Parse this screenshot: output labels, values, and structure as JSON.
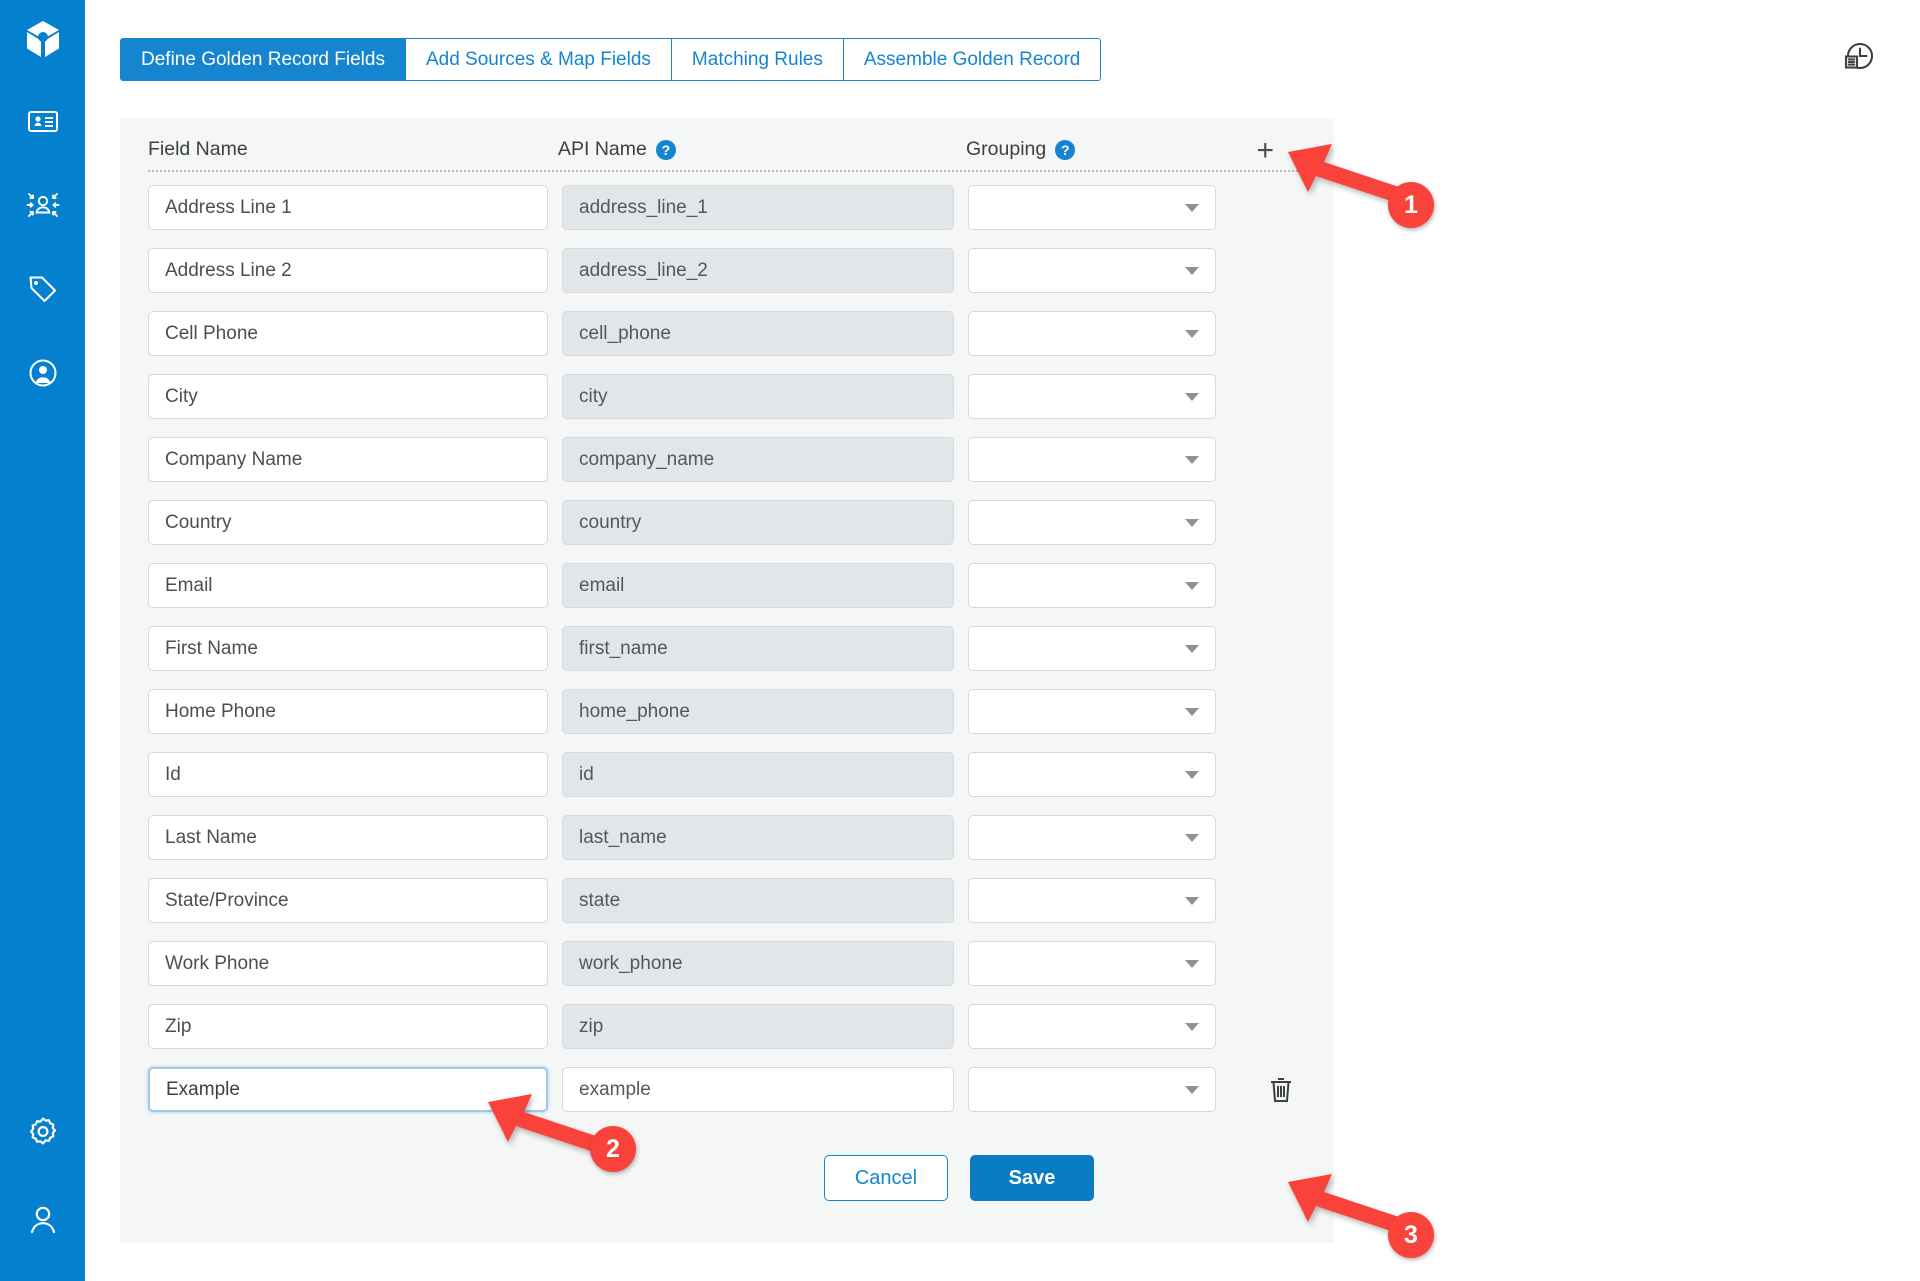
{
  "sidebar": {
    "logo": {
      "icon": "cube-logo-icon"
    },
    "nav_top": [
      {
        "icon": "contact-card-icon",
        "name": "contacts"
      },
      {
        "icon": "person-match-icon",
        "name": "match"
      },
      {
        "icon": "tag-icon",
        "name": "tags"
      },
      {
        "icon": "person-search-icon",
        "name": "person-search"
      }
    ],
    "nav_bottom": [
      {
        "icon": "gear-icon",
        "name": "settings"
      },
      {
        "icon": "user-icon",
        "name": "account"
      }
    ]
  },
  "header": {
    "history_icon": "history-clock-icon"
  },
  "tabs": [
    {
      "label": "Define Golden Record Fields",
      "active": true
    },
    {
      "label": "Add Sources & Map Fields",
      "active": false
    },
    {
      "label": "Matching Rules",
      "active": false
    },
    {
      "label": "Assemble Golden Record",
      "active": false
    }
  ],
  "table": {
    "columns": [
      {
        "label": "Field Name",
        "help": false
      },
      {
        "label": "API Name",
        "help": true,
        "help_glyph": "?"
      },
      {
        "label": "Grouping",
        "help": true,
        "help_glyph": "?"
      }
    ],
    "add_row_glyph": "+",
    "rows": [
      {
        "field_name": "Address Line 1",
        "api_name": "address_line_1",
        "grouping": "",
        "api_editable": false,
        "selected": false,
        "deletable": false
      },
      {
        "field_name": "Address Line 2",
        "api_name": "address_line_2",
        "grouping": "",
        "api_editable": false,
        "selected": false,
        "deletable": false
      },
      {
        "field_name": "Cell Phone",
        "api_name": "cell_phone",
        "grouping": "",
        "api_editable": false,
        "selected": false,
        "deletable": false
      },
      {
        "field_name": "City",
        "api_name": "city",
        "grouping": "",
        "api_editable": false,
        "selected": false,
        "deletable": false
      },
      {
        "field_name": "Company Name",
        "api_name": "company_name",
        "grouping": "",
        "api_editable": false,
        "selected": false,
        "deletable": false
      },
      {
        "field_name": "Country",
        "api_name": "country",
        "grouping": "",
        "api_editable": false,
        "selected": false,
        "deletable": false
      },
      {
        "field_name": "Email",
        "api_name": "email",
        "grouping": "",
        "api_editable": false,
        "selected": false,
        "deletable": false
      },
      {
        "field_name": "First Name",
        "api_name": "first_name",
        "grouping": "",
        "api_editable": false,
        "selected": false,
        "deletable": false
      },
      {
        "field_name": "Home Phone",
        "api_name": "home_phone",
        "grouping": "",
        "api_editable": false,
        "selected": false,
        "deletable": false
      },
      {
        "field_name": "Id",
        "api_name": "id",
        "grouping": "",
        "api_editable": false,
        "selected": false,
        "deletable": false
      },
      {
        "field_name": "Last Name",
        "api_name": "last_name",
        "grouping": "",
        "api_editable": false,
        "selected": false,
        "deletable": false
      },
      {
        "field_name": "State/Province",
        "api_name": "state",
        "grouping": "",
        "api_editable": false,
        "selected": false,
        "deletable": false
      },
      {
        "field_name": "Work Phone",
        "api_name": "work_phone",
        "grouping": "",
        "api_editable": false,
        "selected": false,
        "deletable": false
      },
      {
        "field_name": "Zip",
        "api_name": "zip",
        "grouping": "",
        "api_editable": false,
        "selected": false,
        "deletable": false
      },
      {
        "field_name": "Example",
        "api_name": "example",
        "grouping": "",
        "api_editable": true,
        "selected": true,
        "deletable": true
      }
    ]
  },
  "actions": {
    "cancel_label": "Cancel",
    "save_label": "Save"
  },
  "annotations": [
    {
      "number": "1",
      "target": "add-row-button"
    },
    {
      "number": "2",
      "target": "example-field-name-input"
    },
    {
      "number": "3",
      "target": "save-button"
    }
  ],
  "colors": {
    "brand_blue": "#0480ce",
    "tab_blue": "#1585cf",
    "save_blue": "#0a7cc1",
    "panel_bg": "#f5f6f6",
    "readonly_field_bg": "#e2e6ea",
    "annotation_red": "#f9423a"
  }
}
